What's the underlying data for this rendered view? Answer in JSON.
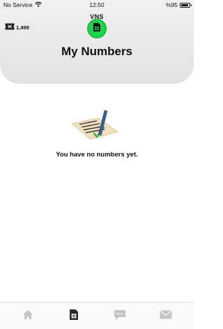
{
  "status_bar": {
    "carrier": "No Service",
    "time": "12:50",
    "battery": "%95",
    "battery_level": 0.95
  },
  "header": {
    "credits": "1,499",
    "brand": "VNS",
    "title": "My Numbers"
  },
  "empty_state": {
    "message": "You have no numbers yet."
  },
  "tabs": [
    {
      "icon": "home-icon",
      "active": false
    },
    {
      "icon": "sim-card-icon",
      "active": true
    },
    {
      "icon": "chat-bubble-icon",
      "active": false
    },
    {
      "icon": "mail-icon",
      "active": false
    }
  ],
  "colors": {
    "accent": "#21d24b",
    "tab_active": "#2b2b2b",
    "tab_inactive": "#c4c4c4",
    "pen": "#3f5f8f",
    "check": "#2fb34a"
  }
}
